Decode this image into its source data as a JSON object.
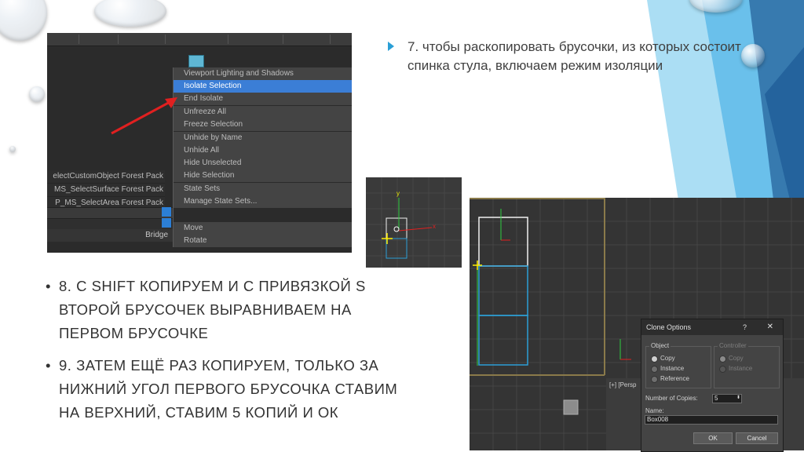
{
  "colors": {
    "accent": "#2a9fd6",
    "menu_selected": "#3b7ed6",
    "deco_light_blue": "#8fd3f0",
    "deco_dark_blue": "#2e6da4"
  },
  "context_menu": {
    "items": [
      "Viewport Lighting and Shadows",
      "Isolate Selection",
      "End Isolate",
      "Unfreeze All",
      "Freeze Selection",
      "Unhide by Name",
      "Unhide All",
      "Hide Unselected",
      "Hide Selection",
      "State Sets",
      "Manage State Sets...",
      "Move",
      "Rotate"
    ],
    "selected_item": "Isolate Selection"
  },
  "left_panel": {
    "lines": [
      "electCustomObject  Forest Pack",
      "MS_SelectSurface  Forest Pack",
      "P_MS_SelectArea  Forest Pack"
    ],
    "bridge_label": "Bridge"
  },
  "step7": {
    "text": "7. чтобы раскопировать брусочки, из которых состоит спинка стула, включаем режим изоляции"
  },
  "step8": {
    "bullet": "•",
    "text": "8. С SHIFT копируем и с привязкой S второй брусочек выравниваем на первом брусочке"
  },
  "step9": {
    "bullet": "•",
    "text": "9. Затем ещё раз копируем, только за нижний угол первого брусочка ставим на верхний, ставим 5 копий и ОК"
  },
  "viewport": {
    "label": "[+] [Persp",
    "axis_y": "y",
    "axis_x": "x"
  },
  "clone_dialog": {
    "title": "Clone Options",
    "help": "?",
    "close": "✕",
    "object_group": "Object",
    "object_options": [
      "Copy",
      "Instance",
      "Reference"
    ],
    "object_selected": "Copy",
    "controller_group": "Controller",
    "controller_options": [
      "Copy",
      "Instance"
    ],
    "copies_label": "Number of Copies:",
    "copies_value": "5",
    "name_label": "Name:",
    "name_value": "Box008",
    "ok": "OK",
    "cancel": "Cancel"
  }
}
